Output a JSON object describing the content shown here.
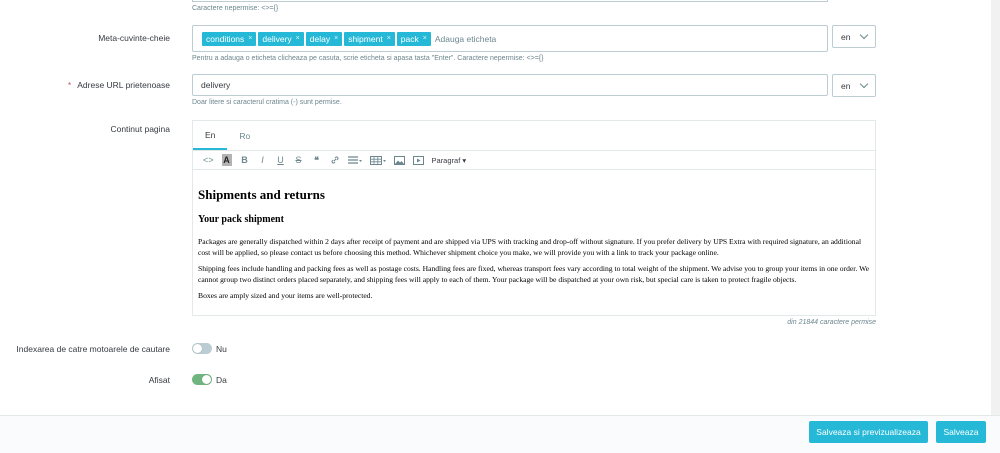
{
  "top_help": "Caractere nepermise: <>={}",
  "meta_keywords": {
    "label": "Meta-cuvinte-cheie",
    "tags": [
      "conditions",
      "delivery",
      "delay",
      "shipment",
      "pack"
    ],
    "placeholder": "Adauga eticheta",
    "lang": "en",
    "help": "Pentru a adauga o eticheta clicheaza pe casuta, scrie eticheta si apasa tasta \"Enter\". Caractere nepermise: <>={}"
  },
  "friendly_url": {
    "label": "Adrese URL prietenoase",
    "required_mark": "*",
    "value": "delivery",
    "lang": "en",
    "help": "Doar litere si caracterul cratima (-) sunt permise."
  },
  "page_content": {
    "label": "Continut pagina",
    "tabs": [
      "En",
      "Ro"
    ],
    "toolbar_para": "Paragraf",
    "heading1": "Shipments and returns",
    "heading2": "Your pack shipment",
    "p1": "Packages are generally dispatched within 2 days after receipt of payment and are shipped via UPS with tracking and drop-off without signature. If you prefer delivery by UPS Extra with required signature, an additional cost will be applied, so please contact us before choosing this method. Whichever shipment choice you make, we will provide you with a link to track your package online.",
    "p2": "Shipping fees include handling and packing fees as well as postage costs. Handling fees are fixed, whereas transport fees vary according to total weight of the shipment. We advise you to group your items in one order. We cannot group two distinct orders placed separately, and shipping fees will apply to each of them. Your package will be dispatched at your own risk, but special care is taken to protect fragile objects.",
    "p3": "Boxes are amply sized and your items are well-protected.",
    "counter": "din 21844 caractere permise"
  },
  "indexing": {
    "label": "Indexarea de catre motoarele de cautare",
    "value": "Nu",
    "on": false
  },
  "displayed": {
    "label": "Afisat",
    "value": "Da",
    "on": true
  },
  "buttons": {
    "save_preview": "Salveaza si previzualizeaza",
    "save": "Salveaza"
  },
  "colors": {
    "accent": "#25b9d7",
    "toggle_on": "#70b580",
    "toggle_off": "#bbcdd2"
  }
}
